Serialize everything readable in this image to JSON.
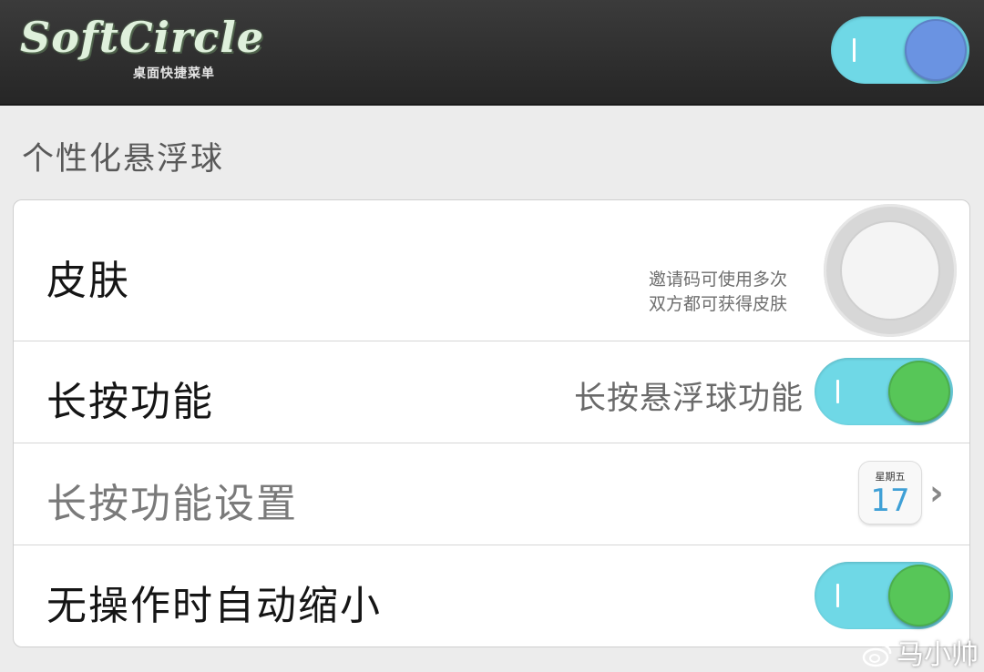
{
  "app": {
    "logo_title": "SoftCircle",
    "logo_subtitle": "桌面快捷菜单",
    "master_toggle_on": true
  },
  "section": {
    "title": "个性化悬浮球"
  },
  "rows": [
    {
      "label": "皮肤",
      "hint_line1": "邀请码可使用多次",
      "hint_line2": "双方都可获得皮肤"
    },
    {
      "label": "长按功能",
      "value": "长按悬浮球功能",
      "toggle_on": true
    },
    {
      "label": "长按功能设置",
      "calendar_weekday": "星期五",
      "calendar_day": "17"
    },
    {
      "label": "无操作时自动缩小",
      "toggle_on": true
    }
  ],
  "watermark": {
    "text": "马小帅"
  },
  "colors": {
    "header_bg": "#2f2f2f",
    "toggle_track": "#6fd8e6",
    "master_knob": "#6a93e2",
    "row_knob": "#57c658",
    "calendar_day": "#3fa0d6"
  },
  "icons": [
    "skin-preview-icon",
    "calendar-icon",
    "chevron-right-icon",
    "weibo-icon"
  ]
}
